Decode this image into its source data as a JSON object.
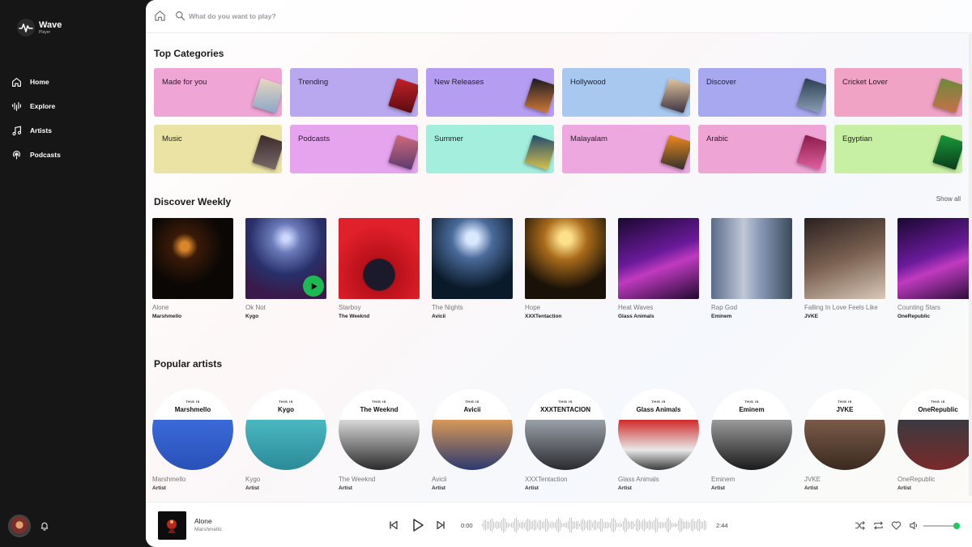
{
  "brand": {
    "name": "Wave",
    "sub": "Player"
  },
  "nav": [
    {
      "label": "Home",
      "icon": "home-icon"
    },
    {
      "label": "Explore",
      "icon": "explore-icon"
    },
    {
      "label": "Artists",
      "icon": "music-note-icon"
    },
    {
      "label": "Podcasts",
      "icon": "podcast-icon"
    }
  ],
  "search": {
    "placeholder": "What do you want to play?"
  },
  "sections": {
    "categories": "Top Categories",
    "weekly": "Discover Weekly",
    "show_all": "Show all",
    "artists": "Popular artists"
  },
  "categories": [
    {
      "label": "Made for you",
      "color": "#efa6d6",
      "art": [
        "#e8d8c0",
        "#8aa6c8"
      ]
    },
    {
      "label": "Trending",
      "color": "#b9a8ef",
      "art": [
        "#c2222a",
        "#5a0b10"
      ]
    },
    {
      "label": "New Releases",
      "color": "#b59df2",
      "art": [
        "#1a1a22",
        "#d07a36"
      ]
    },
    {
      "label": "Hollywood",
      "color": "#a9c8f0",
      "art": [
        "#e3c7a0",
        "#3a3040"
      ]
    },
    {
      "label": "Discover",
      "color": "#a8a8f0",
      "art": [
        "#2c3e50",
        "#8aa0b8"
      ]
    },
    {
      "label": "Cricket Lover",
      "color": "#f0a3c4",
      "art": [
        "#6b8a3a",
        "#c8704a"
      ]
    },
    {
      "label": "Music",
      "color": "#ebe3a4",
      "art": [
        "#3b2a2a",
        "#7a6a6a"
      ]
    },
    {
      "label": "Podcasts",
      "color": "#e6a4ef",
      "art": [
        "#d26a7a",
        "#5a3a70"
      ]
    },
    {
      "label": "Summer",
      "color": "#a4eedd",
      "art": [
        "#1f4a70",
        "#d9c24a"
      ]
    },
    {
      "label": "Malayalam",
      "color": "#eea8e0",
      "art": [
        "#f08a20",
        "#30302a"
      ]
    },
    {
      "label": "Arabic",
      "color": "#efa4d6",
      "art": [
        "#8a1a4a",
        "#e060a0"
      ]
    },
    {
      "label": "Egyptian",
      "color": "#c8f0a4",
      "art": [
        "#1a9a3a",
        "#0a3a1a"
      ]
    }
  ],
  "weekly": [
    {
      "title": "Alone",
      "artist": "Marshmello"
    },
    {
      "title": "Ok Not",
      "artist": "Kygo",
      "playing": true
    },
    {
      "title": "Starboy",
      "artist": "The Weeknd"
    },
    {
      "title": "The Nights",
      "artist": "Avicii"
    },
    {
      "title": "Hope",
      "artist": "XXXTentaction"
    },
    {
      "title": "Heat Waves",
      "artist": "Glass Animals"
    },
    {
      "title": "Rap God",
      "artist": "Eminem"
    },
    {
      "title": "Falling In Love Feels Like",
      "artist": "JVKE"
    },
    {
      "title": "Counting Stars",
      "artist": "OneRepublic"
    }
  ],
  "artists": [
    {
      "name": "Marshmello",
      "role": "Artist",
      "banner": "Marshmello",
      "this_is": "THIS IS"
    },
    {
      "name": "Kygo",
      "role": "Artist",
      "banner": "Kygo",
      "this_is": "THIS IS"
    },
    {
      "name": "The Weeknd",
      "role": "Artist",
      "banner": "The Weeknd",
      "this_is": "THIS IS"
    },
    {
      "name": "Avicii",
      "role": "Artist",
      "banner": "Avicii",
      "this_is": "THIS IS"
    },
    {
      "name": "XXXTentaction",
      "role": "Artist",
      "banner": "XXXTENTACION",
      "this_is": "THIS IS"
    },
    {
      "name": "Glass Animals",
      "role": "Artist",
      "banner": "Glass Animals",
      "this_is": "THIS IS"
    },
    {
      "name": "Eminem",
      "role": "Artist",
      "banner": "Eminem",
      "this_is": "THIS IS"
    },
    {
      "name": "JVKE",
      "role": "Artist",
      "banner": "JVKE",
      "this_is": "THIS IS"
    },
    {
      "name": "OneRepublic",
      "role": "Artist",
      "banner": "OneRepublic",
      "this_is": "THIS IS"
    }
  ],
  "player": {
    "title": "Alone",
    "artist": "Marshmello",
    "elapsed": "0:00",
    "duration": "2:44",
    "progress": 0,
    "volume": 0.9,
    "accent": "#22c55e"
  }
}
